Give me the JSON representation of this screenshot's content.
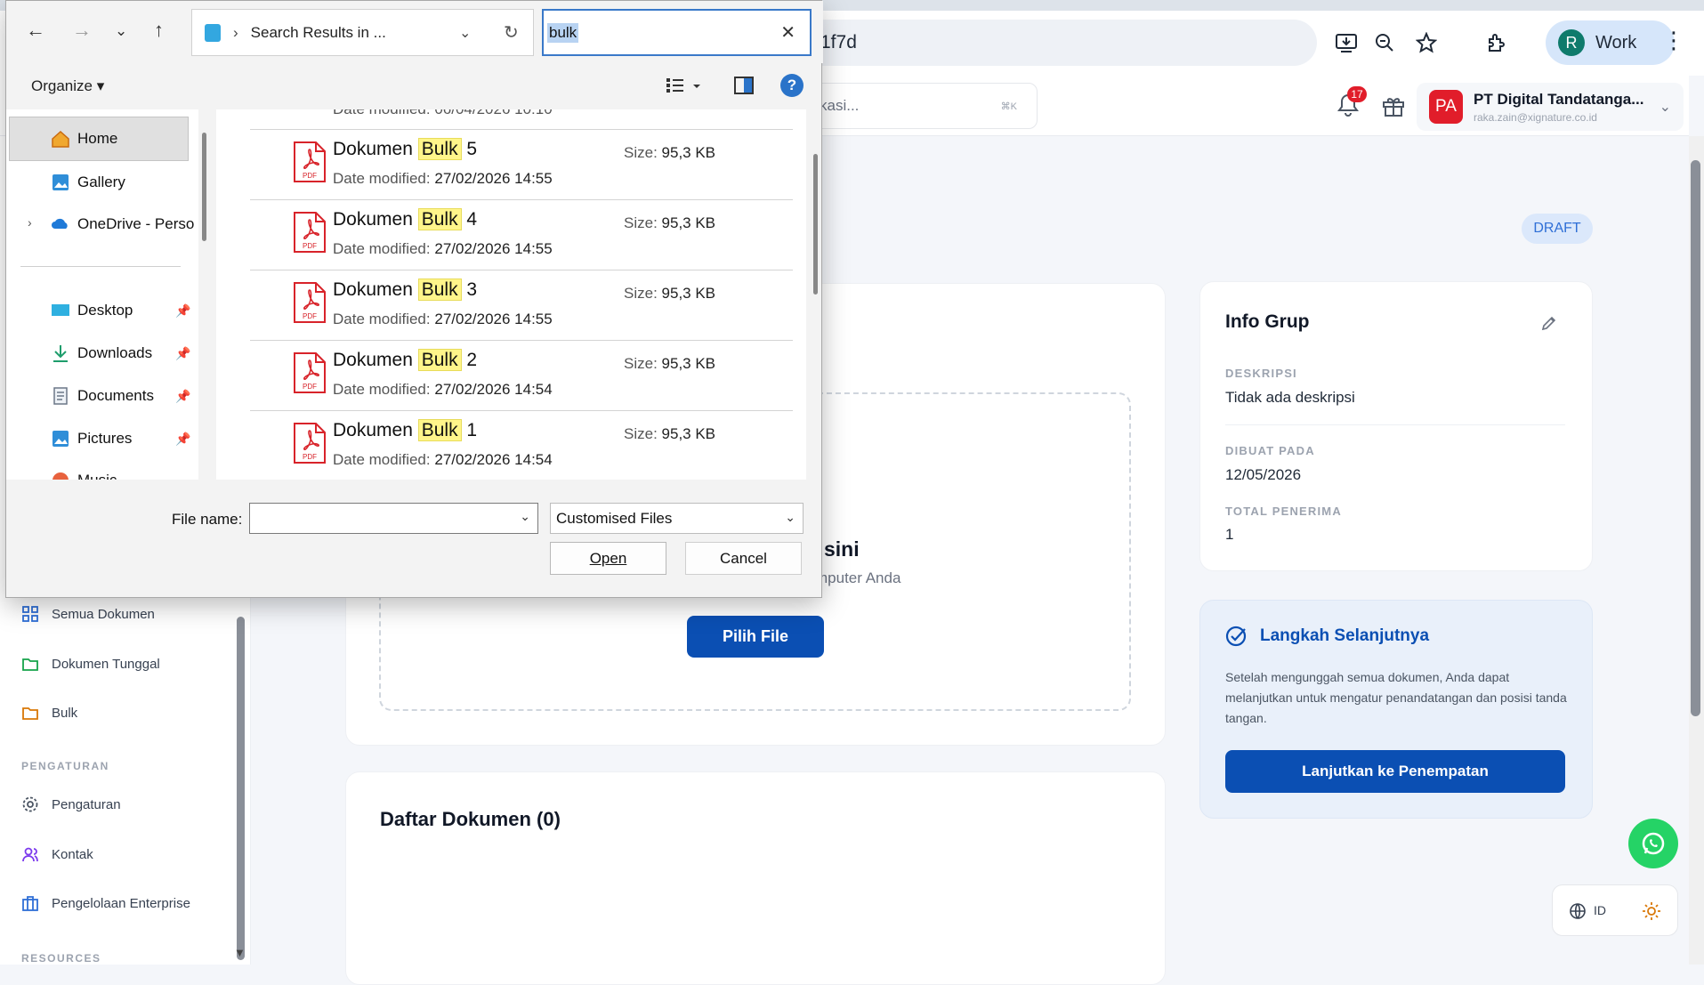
{
  "browser": {
    "url_fragment": "1f7d",
    "profile_initial": "R",
    "profile_label": "Work"
  },
  "app": {
    "search_placeholder": "kasi...",
    "search_shortcut": "⌘K",
    "notification_count": "17",
    "org": {
      "initials": "PA",
      "name": "PT Digital Tandatanga...",
      "email": "raka.zain@xignature.co.id"
    },
    "status_badge": "DRAFT",
    "sidebar": {
      "items": [
        {
          "label": "Semua Dokumen"
        },
        {
          "label": "Dokumen Tunggal"
        },
        {
          "label": "Bulk"
        }
      ],
      "settings_section": "PENGATURAN",
      "settings_items": [
        {
          "label": "Pengaturan"
        },
        {
          "label": "Kontak"
        },
        {
          "label": "Pengelolaan Enterprise"
        }
      ],
      "resources_section": "RESOURCES"
    },
    "upload": {
      "title_partial": "sini",
      "subtitle_partial": "mputer Anda",
      "pick_button": "Pilih File"
    },
    "document_list": {
      "title": "Daftar Dokumen (0)"
    },
    "info": {
      "title": "Info Grup",
      "desc_label": "DESKRIPSI",
      "desc_value": "Tidak ada deskripsi",
      "created_label": "DIBUAT PADA",
      "created_value": "12/05/2026",
      "recipients_label": "TOTAL PENERIMA",
      "recipients_value": "1"
    },
    "next_steps": {
      "title": "Langkah Selanjutnya",
      "body": "Setelah mengunggah semua dokumen, Anda dapat melanjutkan untuk mengatur penandatangan dan posisi tanda tangan.",
      "button": "Lanjutkan ke Penempatan"
    },
    "language": "ID"
  },
  "dialog": {
    "address": "Search Results in ...",
    "search_value": "bulk",
    "organize": "Organize",
    "nav_pane": [
      {
        "label": "Home"
      },
      {
        "label": "Gallery"
      },
      {
        "label": "OneDrive - Perso"
      },
      {
        "label": "Desktop"
      },
      {
        "label": "Downloads"
      },
      {
        "label": "Documents"
      },
      {
        "label": "Pictures"
      },
      {
        "label": "Music"
      }
    ],
    "partial_top_row": "Date modified: 06/04/2026 10:10",
    "date_label": "Date modified:",
    "size_label": "Size:",
    "results": [
      {
        "prefix": "Dokumen ",
        "match": "Bulk",
        "suffix": " 5",
        "date": "27/02/2026 14:55",
        "size": "95,3 KB"
      },
      {
        "prefix": "Dokumen ",
        "match": "Bulk",
        "suffix": " 4",
        "date": "27/02/2026 14:55",
        "size": "95,3 KB"
      },
      {
        "prefix": "Dokumen ",
        "match": "Bulk",
        "suffix": " 3",
        "date": "27/02/2026 14:55",
        "size": "95,3 KB"
      },
      {
        "prefix": "Dokumen ",
        "match": "Bulk",
        "suffix": " 2",
        "date": "27/02/2026 14:54",
        "size": "95,3 KB"
      },
      {
        "prefix": "Dokumen ",
        "match": "Bulk",
        "suffix": " 1",
        "date": "27/02/2026 14:54",
        "size": "95,3 KB"
      }
    ],
    "file_name_label": "File name:",
    "file_name_value": "",
    "file_type": "Customised Files",
    "open_button": "Open",
    "cancel_button": "Cancel"
  }
}
